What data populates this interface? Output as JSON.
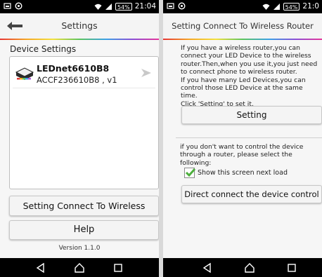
{
  "status": {
    "battery": "54%",
    "time_left": "21:04",
    "time_right": "21:0"
  },
  "settings_screen": {
    "title": "Settings",
    "section_label": "Device Settings",
    "device": {
      "name": "LEDnet6610B8",
      "mac": "ACCF236610B8 , v1"
    },
    "wifi_button": "Setting Connect To Wireless Router",
    "help_button": "Help",
    "version": "Version 1.1.0"
  },
  "router_screen": {
    "title": "Setting Connect To Wireless Router",
    "info_text": "If you have a wireless router,you can connect your LED Device to the wireless router.Then,when you use it,you just need to connect phone to wireless router.\nIf you have many Led Devices,you can control those LED Device at the same time.\n Click 'Setting' to set it.",
    "setting_button": "Setting",
    "alt_text": "if you don't want to control the device through a router, please select the following:",
    "checkbox_label": "Show this screen next load",
    "checkbox_checked": true,
    "direct_button": "Direct connect the device control"
  },
  "icons": {
    "status_left": [
      "image-icon",
      "sync-icon"
    ],
    "status_right": [
      "wifi-icon",
      "signal-icon",
      "battery-icon"
    ],
    "nav": [
      "back-nav-icon",
      "home-nav-icon",
      "recents-nav-icon"
    ]
  },
  "colors": {
    "check": "#4caf3c",
    "status_bar": "#000000"
  }
}
